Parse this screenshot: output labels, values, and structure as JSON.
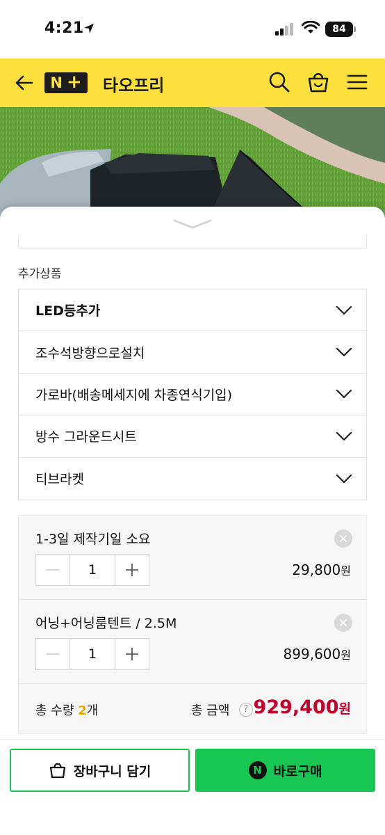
{
  "status_bar": {
    "time": "4:21",
    "battery": "84"
  },
  "header": {
    "logo_text": "N+",
    "store_name": "타오프리",
    "icons": [
      "back-arrow-icon",
      "search-icon",
      "shopping-bag-icon",
      "menu-icon"
    ],
    "background_color": "#fde03b"
  },
  "sheet": {
    "section_title": "추가상품",
    "addons": [
      {
        "label": "LED등추가"
      },
      {
        "label": "조수석방향으로설치"
      },
      {
        "label": "가로바(배송메세지에 차종연식기입)"
      },
      {
        "label": "방수 그라운드시트"
      },
      {
        "label": "티브라켓"
      }
    ],
    "cart_items": [
      {
        "name": "1-3일 제작기일 소요",
        "qty": "1",
        "price": "29,800",
        "currency": "원"
      },
      {
        "name": "어닝+어닝룸텐트 / 2.5M",
        "qty": "1",
        "price": "899,600",
        "currency": "원"
      }
    ],
    "totals": {
      "qty_label": "총 수량",
      "qty_value": "2",
      "qty_unit": "개",
      "amount_label": "총 금액",
      "help_mark": "?",
      "amount_value": "929,400",
      "currency": "원"
    }
  },
  "actions": {
    "cart_label": "장바구니 담기",
    "buy_label": "바로구매",
    "buy_badge": "N",
    "accent_color": "#17c752"
  }
}
